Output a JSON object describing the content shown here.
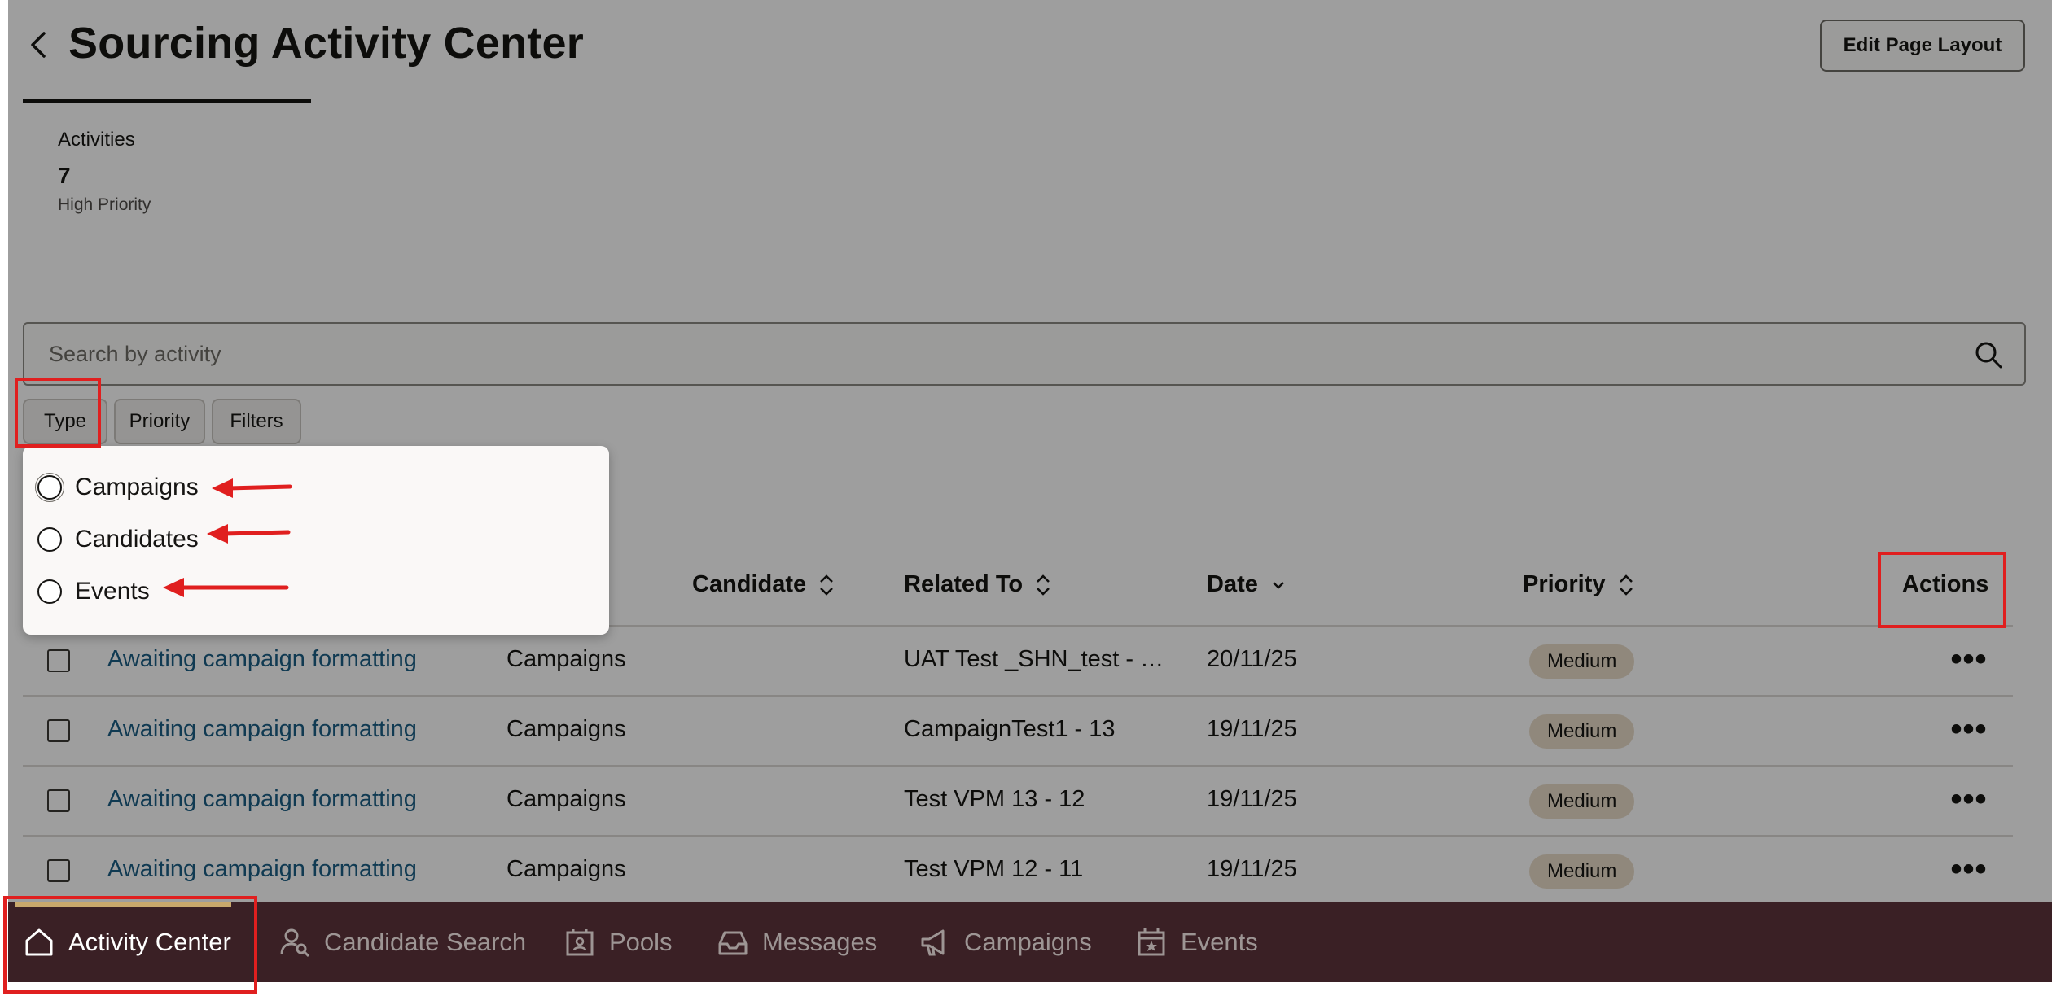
{
  "header": {
    "title": "Sourcing Activity Center",
    "edit_layout_label": "Edit Page Layout"
  },
  "metric": {
    "label": "Activities",
    "value": "7",
    "sublabel": "High Priority"
  },
  "search": {
    "placeholder": "Search by activity"
  },
  "filters": {
    "type": "Type",
    "priority": "Priority",
    "filters": "Filters"
  },
  "type_popup": {
    "options": [
      "Campaigns",
      "Candidates",
      "Events"
    ]
  },
  "table": {
    "columns": {
      "candidate": "Candidate",
      "related_to": "Related To",
      "date": "Date",
      "priority": "Priority",
      "actions": "Actions"
    },
    "rows": [
      {
        "activity": "Awaiting campaign formatting",
        "type": "Campaigns",
        "related": "UAT Test _SHN_test - …",
        "date": "20/11/25",
        "priority": "Medium"
      },
      {
        "activity": "Awaiting campaign formatting",
        "type": "Campaigns",
        "related": "CampaignTest1 - 13",
        "date": "19/11/25",
        "priority": "Medium"
      },
      {
        "activity": "Awaiting campaign formatting",
        "type": "Campaigns",
        "related": "Test VPM 13 - 12",
        "date": "19/11/25",
        "priority": "Medium"
      },
      {
        "activity": "Awaiting campaign formatting",
        "type": "Campaigns",
        "related": "Test VPM 12 - 11",
        "date": "19/11/25",
        "priority": "Medium"
      }
    ]
  },
  "nav": {
    "items": [
      {
        "label": "Activity Center",
        "icon": "home-icon",
        "active": true
      },
      {
        "label": "Candidate Search",
        "icon": "person-search-icon"
      },
      {
        "label": "Pools",
        "icon": "pools-icon"
      },
      {
        "label": "Messages",
        "icon": "inbox-icon"
      },
      {
        "label": "Campaigns",
        "icon": "megaphone-icon"
      },
      {
        "label": "Events",
        "icon": "calendar-star-icon"
      }
    ]
  },
  "colors": {
    "nav_background": "#3a2025",
    "link": "#1b5e85",
    "badge": "#e9dcc9",
    "annotation": "#e01f1f"
  }
}
